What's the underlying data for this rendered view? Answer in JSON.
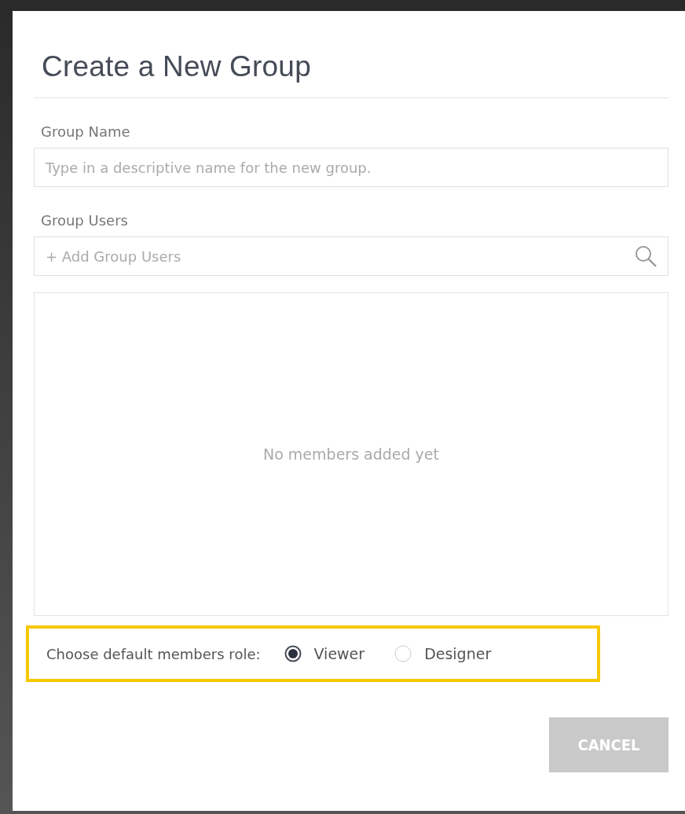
{
  "dialog": {
    "title": "Create a New Group",
    "group_name": {
      "label": "Group Name",
      "placeholder": "Type in a descriptive name for the new group."
    },
    "group_users": {
      "label": "Group Users",
      "placeholder": "+ Add Group Users",
      "empty_message": "No members added yet"
    },
    "role": {
      "label": "Choose default members role:",
      "highlighted": true,
      "options": [
        {
          "label": "Viewer",
          "selected": true
        },
        {
          "label": "Designer",
          "selected": false
        }
      ]
    },
    "buttons": [
      {
        "label": "CANCEL",
        "disabled": true
      }
    ]
  }
}
